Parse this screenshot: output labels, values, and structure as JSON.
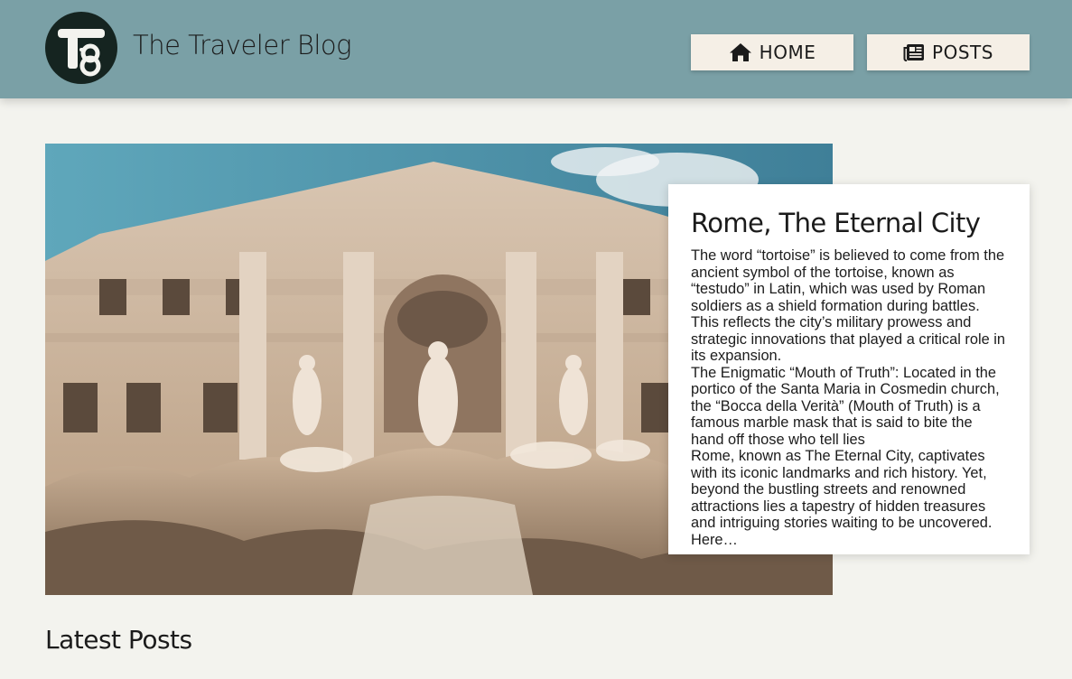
{
  "header": {
    "site_title": "The Traveler Blog",
    "logo_icon": "monogram-logo-icon",
    "nav": [
      {
        "label": "HOME",
        "icon": "home-icon"
      },
      {
        "label": "POSTS",
        "icon": "newspaper-icon"
      }
    ]
  },
  "featured_post": {
    "image_icon": "trevi-fountain-photo",
    "title": "Rome, The Eternal City",
    "paragraphs": [
      "The word “tortoise” is believed to come from the ancient symbol of the tortoise, known as “testudo” in Latin, which was used by Roman soldiers as a shield formation during battles. This reflects the city’s military prowess and strategic innovations that played a critical role in its expansion.",
      "The Enigmatic “Mouth of Truth”: Located in the portico of the Santa Maria in Cosmedin church, the “Bocca della Verità” (Mouth of Truth) is a famous marble mask that is said to bite the hand off those who tell lies",
      "Rome, known as The Eternal City, captivates with its iconic landmarks and rich history. Yet, beyond the bustling streets and renowned attractions lies a tapestry of hidden treasures and intriguing stories waiting to be uncovered. Here…"
    ]
  },
  "latest_posts": {
    "heading": "Latest Posts"
  },
  "colors": {
    "header_bg": "#7aa0a6",
    "page_bg": "#f3f3ee",
    "nav_button_bg": "#f5efe6",
    "logo_bg": "#152420"
  }
}
